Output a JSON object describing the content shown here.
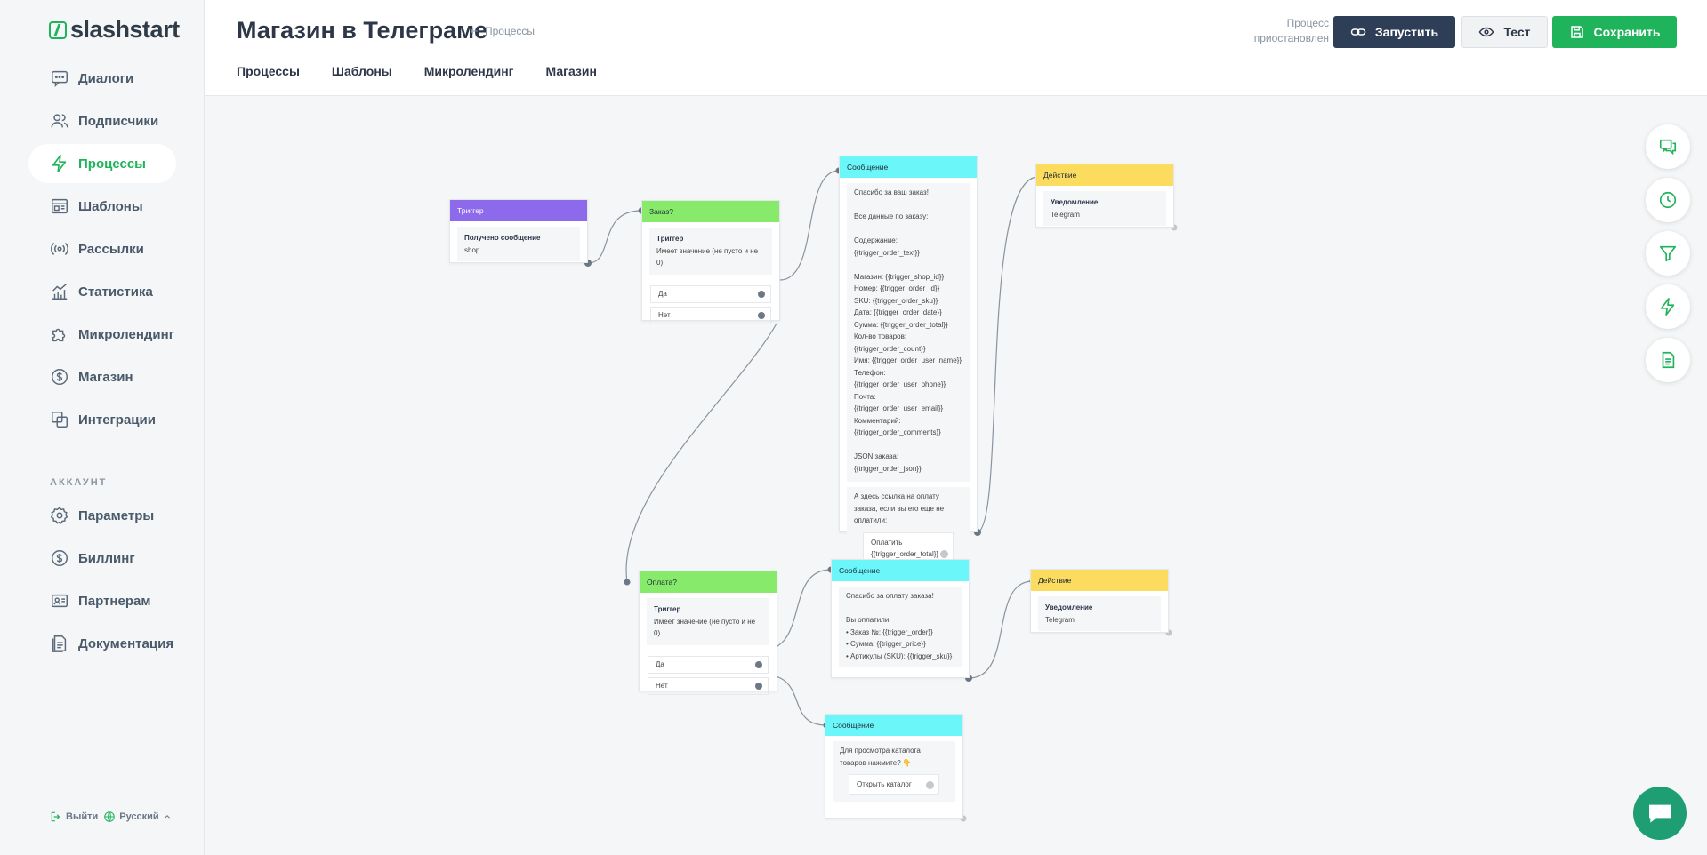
{
  "brand": {
    "name": "slashstart"
  },
  "sidebar": {
    "nav": [
      {
        "label": "Диалоги",
        "icon": "chat-icon"
      },
      {
        "label": "Подписчики",
        "icon": "users-icon"
      },
      {
        "label": "Процессы",
        "icon": "lightning-icon",
        "active": true
      },
      {
        "label": "Шаблоны",
        "icon": "template-icon"
      },
      {
        "label": "Рассылки",
        "icon": "broadcast-icon"
      },
      {
        "label": "Статистика",
        "icon": "stats-icon"
      },
      {
        "label": "Микролендинг",
        "icon": "puzzle-icon"
      },
      {
        "label": "Магазин",
        "icon": "dollar-icon"
      },
      {
        "label": "Интеграции",
        "icon": "integrations-icon"
      }
    ],
    "account_label": "АККАУНТ",
    "account": [
      {
        "label": "Параметры",
        "icon": "gear-icon"
      },
      {
        "label": "Биллинг",
        "icon": "dollar-icon"
      },
      {
        "label": "Партнерам",
        "icon": "partner-icon"
      },
      {
        "label": "Документация",
        "icon": "document-icon"
      }
    ],
    "footer": {
      "logout": "Выйти",
      "language": "Русский"
    }
  },
  "header": {
    "title": "Магазин в Телеграме",
    "breadcrumb": "Процессы",
    "tabs": [
      "Процессы",
      "Шаблоны",
      "Микролендинг",
      "Магазин"
    ],
    "status": "Процесс приостановлен",
    "run_label": "Запустить",
    "test_label": "Тест",
    "save_label": "Сохранить"
  },
  "flow": {
    "trigger": {
      "title": "Триггер",
      "event": "Получено сообщение",
      "value": "shop"
    },
    "cond_order": {
      "title": "Заказ?",
      "label": "Триггер",
      "rule": "Имеет значение (не пусто и не 0)",
      "yes": "Да",
      "no": "Нет"
    },
    "msg_order": {
      "title": "Сообщение",
      "text": "Спасибо за ваш заказ!\n\nВсе данные по заказу:\n\nСодержание: {{trigger_order_text}}\n\nМагазин: {{trigger_shop_id}}\nНомер: {{trigger_order_id}}\nSKU: {{trigger_order_sku}}\nДата: {{trigger_order_date}}\nСумма: {{trigger_order_total}}\nКол-во товаров:\n{{trigger_order_count}}\nИмя: {{trigger_order_user_name}}\nТелефон:\n{{trigger_order_user_phone}}\nПочта: {{trigger_order_user_email}}\nКомментарий:\n{{trigger_order_comments}}\n\nJSON заказа: {{trigger_order_json}}",
      "text2": "А здесь ссылка на оплату заказа, если вы его еще не оплатили:",
      "button": "Оплатить {{trigger_order_total}} р."
    },
    "action1": {
      "title": "Действие",
      "label": "Уведомление",
      "value": "Telegram"
    },
    "cond_pay": {
      "title": "Оплата?",
      "label": "Триггер",
      "rule": "Имеет значение (не пусто и не 0)",
      "yes": "Да",
      "no": "Нет"
    },
    "msg_paid": {
      "title": "Сообщение",
      "text": "Спасибо за оплату заказа!\n\nВы оплатили:\n• Заказ №: {{trigger_order}}\n• Сумма: {{trigger_price}}\n• Артикулы (SKU): {{trigger_sku}}"
    },
    "action2": {
      "title": "Действие",
      "label": "Уведомление",
      "value": "Telegram"
    },
    "msg_catalog": {
      "title": "Сообщение",
      "text": "Для просмотра каталога товаров нажмите? 👇",
      "button": "Открыть каталог"
    }
  },
  "tools": [
    "comments-icon",
    "clock-icon",
    "filter-icon",
    "lightning-icon",
    "document-icon"
  ],
  "colors": {
    "accent": "#1fb35b",
    "dark_button": "#2e3e57",
    "trigger": "#8c6aeb",
    "condition": "#87ea6b",
    "message": "#6bf6f9",
    "action": "#fcdc5f"
  }
}
